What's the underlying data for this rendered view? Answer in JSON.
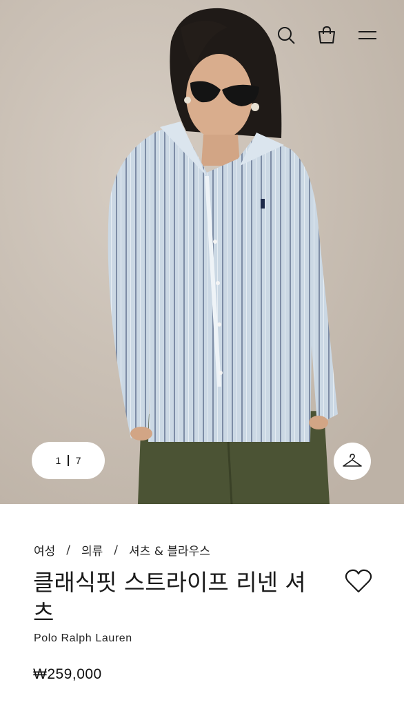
{
  "header": {
    "search_icon": "search-icon",
    "bag_icon": "shopping-bag-icon",
    "menu_icon": "hamburger-menu-icon"
  },
  "gallery": {
    "current": "1",
    "total": "7",
    "hanger_icon": "hanger-icon"
  },
  "breadcrumb": {
    "items": [
      "여성",
      "의류",
      "셔츠 & 블라우스"
    ],
    "separator": "/"
  },
  "product": {
    "title": "클래식핏 스트라이프 리넨 셔츠",
    "brand": "Polo Ralph Lauren",
    "price": "₩259,000",
    "wishlist_icon": "heart-icon"
  },
  "colors": {
    "background": "#ffffff",
    "text": "#1a1a1a",
    "hero_bg": "#cfc5ba",
    "shirt": "#c9d6e3",
    "pants": "#4a5233"
  }
}
